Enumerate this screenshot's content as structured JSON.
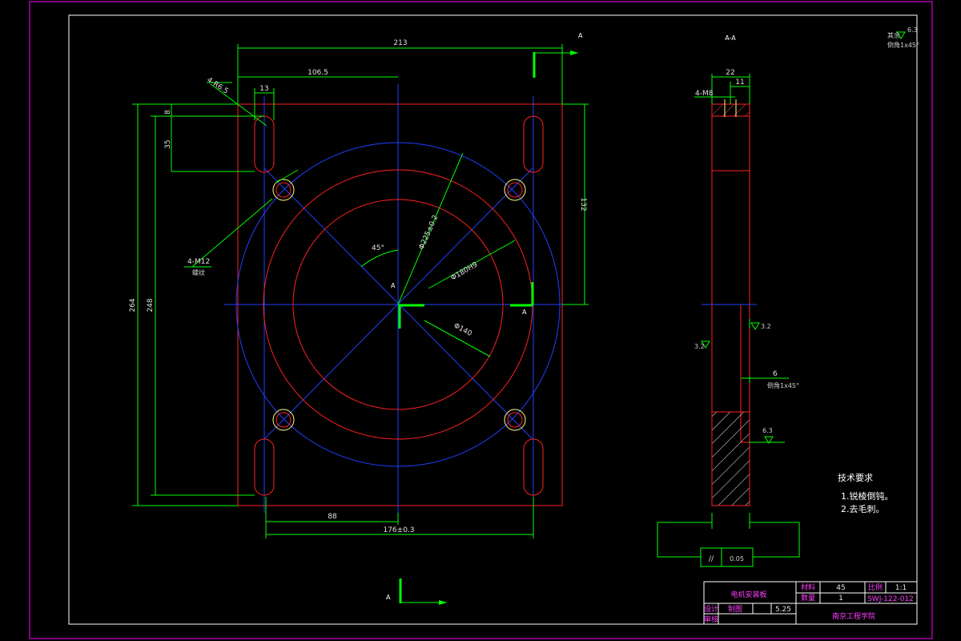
{
  "colors": {
    "background": "#000000",
    "frame": "#ff00ff",
    "outline": "#ff2020",
    "centerline": "#2040ff",
    "dimension": "#00ff00",
    "bold": "#00ff00",
    "hole": "#ffff80",
    "text": "#ffffff"
  },
  "front_view": {
    "section_mark_top": "A",
    "section_mark_bottom": "A",
    "section_mark_center_left": "A",
    "section_mark_center_right": "A",
    "dim_width_total": "213",
    "dim_half_width": "106.5",
    "dim_slot_offset": "13",
    "dim_slot_callout": "4-R6.5",
    "dim_top_small": "8",
    "dim_slot_length": "35",
    "dim_height_total": "264",
    "dim_height_inner": "248",
    "dim_right_half": "132",
    "dim_bottom_half": "88",
    "dim_bottom_total": "176±0.3",
    "dim_hole_callout": "4-M12",
    "dim_hole_note": "螺纹",
    "dim_angle": "45°",
    "dim_pcd": "Φ225±0.2",
    "dim_ring_outer": "Φ180H9",
    "dim_ring_inner": "Φ140"
  },
  "side_view": {
    "title": "A-A",
    "dim_width": "22",
    "dim_step": "11",
    "dim_thread": "4-M8",
    "dim_depth": "6",
    "dim_chamfer": "倒角1x45°",
    "rough_a": "3.2",
    "rough_b": "3.2",
    "rough_c": "6.3"
  },
  "roughness_corner": {
    "value": "6.3",
    "label_a": "其余",
    "label_b": "倒角1x45°"
  },
  "tech_req": {
    "title": "技术要求",
    "item_1": "1.锐棱倒钝。",
    "item_2": "2.去毛刺。"
  },
  "tolerance_frame": {
    "symbol": "//",
    "value": "0.05"
  },
  "title_block": {
    "part_name": "电机安装板",
    "material_label": "材料",
    "material_value": "45",
    "qty_label": "数量",
    "qty_value": "1",
    "scale_label": "比例",
    "scale_value": "1:1",
    "drawing_no": "SWJ-122-012",
    "designer_label": "设计",
    "drawer_label": "制图",
    "check_label": "审核",
    "date": "5.25",
    "school": "南京工程学院"
  }
}
